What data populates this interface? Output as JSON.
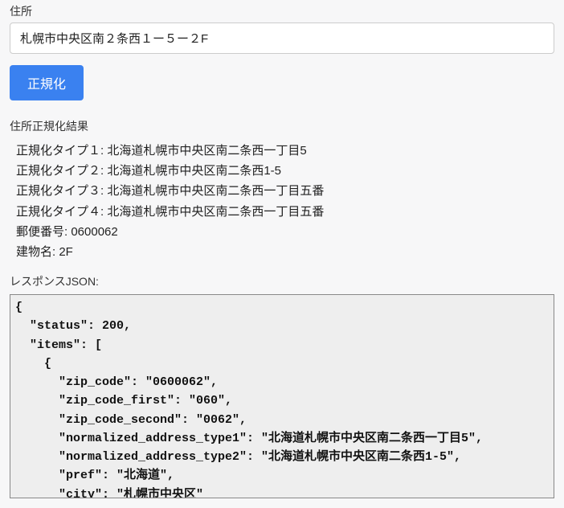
{
  "inputSection": {
    "label": "住所",
    "value": "札幌市中央区南２条西１ー５ー２F",
    "buttonLabel": "正規化"
  },
  "resultSection": {
    "title": "住所正規化結果",
    "lines": {
      "type1Label": "正規化タイプ１: ",
      "type1Value": "北海道札幌市中央区南二条西一丁目5",
      "type2Label": "正規化タイプ２: ",
      "type2Value": "北海道札幌市中央区南二条西1-5",
      "type3Label": "正規化タイプ３: ",
      "type3Value": "北海道札幌市中央区南二条西一丁目五番",
      "type4Label": "正規化タイプ４: ",
      "type4Value": "北海道札幌市中央区南二条西一丁目五番",
      "zipLabel": "郵便番号: ",
      "zipValue": "0600062",
      "buildingLabel": "建物名: ",
      "buildingValue": "2F"
    }
  },
  "responseSection": {
    "label": "レスポンスJSON:",
    "json": "{\n  \"status\": 200,\n  \"items\": [\n    {\n      \"zip_code\": \"0600062\",\n      \"zip_code_first\": \"060\",\n      \"zip_code_second\": \"0062\",\n      \"normalized_address_type1\": \"北海道札幌市中央区南二条西一丁目5\",\n      \"normalized_address_type2\": \"北海道札幌市中央区南二条西1-5\",\n      \"pref\": \"北海道\",\n      \"city\": \"札幌市中央区\""
  }
}
